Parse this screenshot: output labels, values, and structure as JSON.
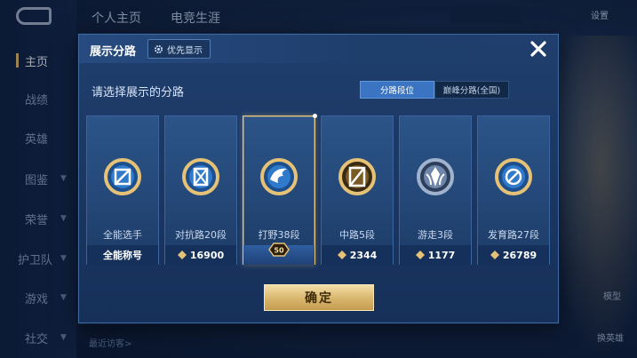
{
  "nav": {
    "items": [
      {
        "label": "主页",
        "chevron": false
      },
      {
        "label": "战绩",
        "chevron": false
      },
      {
        "label": "英雄",
        "chevron": false
      },
      {
        "label": "图鉴",
        "chevron": true
      },
      {
        "label": "荣誉",
        "chevron": true
      },
      {
        "label": "护卫队",
        "chevron": true
      },
      {
        "label": "游戏",
        "chevron": true
      },
      {
        "label": "社交",
        "chevron": true
      }
    ]
  },
  "top_tabs": [
    "个人主页",
    "电竞生涯"
  ],
  "top_right": {
    "left_label": "",
    "right_label": "设置"
  },
  "background": {
    "bottom_text": "最近访客>",
    "right_text_1": "",
    "right_text_2": "模型",
    "right_text_3": "换英雄"
  },
  "modal": {
    "title": "展示分路",
    "priority_button": "优先显示",
    "subtitle": "请选择展示的分路",
    "segments": [
      {
        "label": "分路段位",
        "active": true
      },
      {
        "label": "巅峰分路(全国)",
        "active": false
      }
    ],
    "cards": [
      {
        "name": "全能选手",
        "score": "全能称号",
        "has_diamond": false,
        "emblem": "all-round",
        "selected": false
      },
      {
        "name": "对抗路20段",
        "score": "16900",
        "has_diamond": true,
        "emblem": "clash-lane",
        "selected": false
      },
      {
        "name": "打野38段",
        "score": "",
        "has_diamond": false,
        "emblem": "jungle",
        "selected": true,
        "rank_tag": "50"
      },
      {
        "name": "中路5段",
        "score": "2344",
        "has_diamond": true,
        "emblem": "mid-lane",
        "selected": false
      },
      {
        "name": "游走3段",
        "score": "1177",
        "has_diamond": true,
        "emblem": "roam",
        "selected": false
      },
      {
        "name": "发育路27段",
        "score": "26789",
        "has_diamond": true,
        "emblem": "farm-lane",
        "selected": false
      }
    ],
    "confirm_label": "确定"
  },
  "colors": {
    "gold": "#e6c276",
    "accent_blue": "#3a74c2",
    "panel": "#1a3560"
  }
}
